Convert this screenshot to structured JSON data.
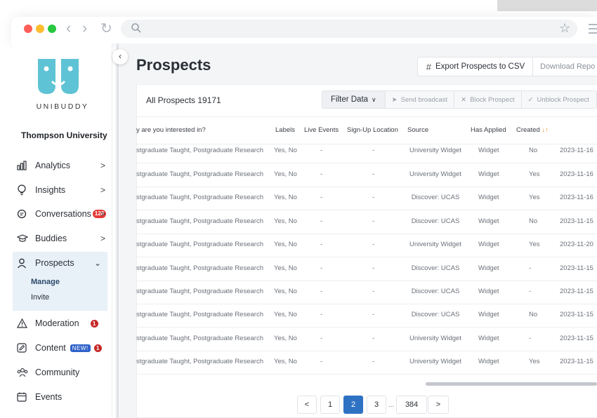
{
  "sidebar": {
    "brand": "UNIBUDDY",
    "university": "Thompson University",
    "items": [
      {
        "label": "Analytics",
        "chevron": ">"
      },
      {
        "label": "Insights",
        "chevron": ">"
      },
      {
        "label": "Conversations",
        "badge": "128",
        "chevron": ">"
      },
      {
        "label": "Buddies",
        "chevron": ">"
      },
      {
        "label": "Prospects",
        "chevron": "⌄"
      },
      {
        "label": "Moderation",
        "badge": "1"
      },
      {
        "label": "Content",
        "tag": "NEW!",
        "badge": "1"
      },
      {
        "label": "Community"
      },
      {
        "label": "Events"
      }
    ],
    "sub_items": [
      "Manage",
      "Invite"
    ]
  },
  "header": {
    "title": "Prospects",
    "export_label": "Export Prospects to CSV",
    "download_label": "Download Repo"
  },
  "toolbar": {
    "all_prospects": "All Prospects 19171",
    "filter": "Filter Data",
    "send_broadcast": "Send broadcast",
    "block": "Block Prospect",
    "unblock": "Unblock Prospect"
  },
  "table": {
    "columns": [
      "y are you interested in?",
      "Labels",
      "Live Events",
      "Sign-Up Location",
      "Source",
      "Has Applied",
      "Created"
    ],
    "rows": [
      [
        "stgraduate Taught, Postgraduate Research",
        "Yes, No",
        "-",
        "-",
        "University Widget",
        "Widget",
        "No",
        "2023-11-16"
      ],
      [
        "stgraduate Taught, Postgraduate Research",
        "Yes, No",
        "-",
        "-",
        "University Widget",
        "Widget",
        "Yes",
        "2023-11-16"
      ],
      [
        "stgraduate Taught, Postgraduate Research",
        "Yes, No",
        "-",
        "-",
        "Discover: UCAS",
        "Widget",
        "Yes",
        "2023-11-16"
      ],
      [
        "stgraduate Taught, Postgraduate Research",
        "Yes, No",
        "-",
        "-",
        "Discover: UCAS",
        "Widget",
        "No",
        "2023-11-15"
      ],
      [
        "stgraduate Taught, Postgraduate Research",
        "Yes, No",
        "-",
        "-",
        "University Widget",
        "Widget",
        "Yes",
        "2023-11-20"
      ],
      [
        "stgraduate Taught, Postgraduate Research",
        "Yes, No",
        "-",
        "-",
        "Discover: UCAS",
        "Widget",
        "-",
        "2023-11-15"
      ],
      [
        "stgraduate Taught, Postgraduate Research",
        "Yes, No",
        "-",
        "-",
        "Discover: UCAS",
        "Widget",
        "-",
        "2023-11-15"
      ],
      [
        "stgraduate Taught, Postgraduate Research",
        "Yes, No",
        "-",
        "-",
        "Discover: UCAS",
        "Widget",
        "No",
        "2023-11-15"
      ],
      [
        "stgraduate Taught, Postgraduate Research",
        "Yes, No",
        "-",
        "-",
        "University Widget",
        "Widget",
        "-",
        "2023-11-15"
      ],
      [
        "stgraduate Taught, Postgraduate Research",
        "Yes, No",
        "-",
        "-",
        "University Widget",
        "Widget",
        "Yes",
        "2023-11-15"
      ]
    ]
  },
  "pagination": {
    "prev": "<",
    "pages": [
      "1",
      "2",
      "3"
    ],
    "ellipsis": "...",
    "last": "384",
    "next": ">",
    "current": "2"
  },
  "colors": {
    "accent": "#2f72c4",
    "brand_teal": "#5ec3d4",
    "badge_red": "#e53935"
  }
}
